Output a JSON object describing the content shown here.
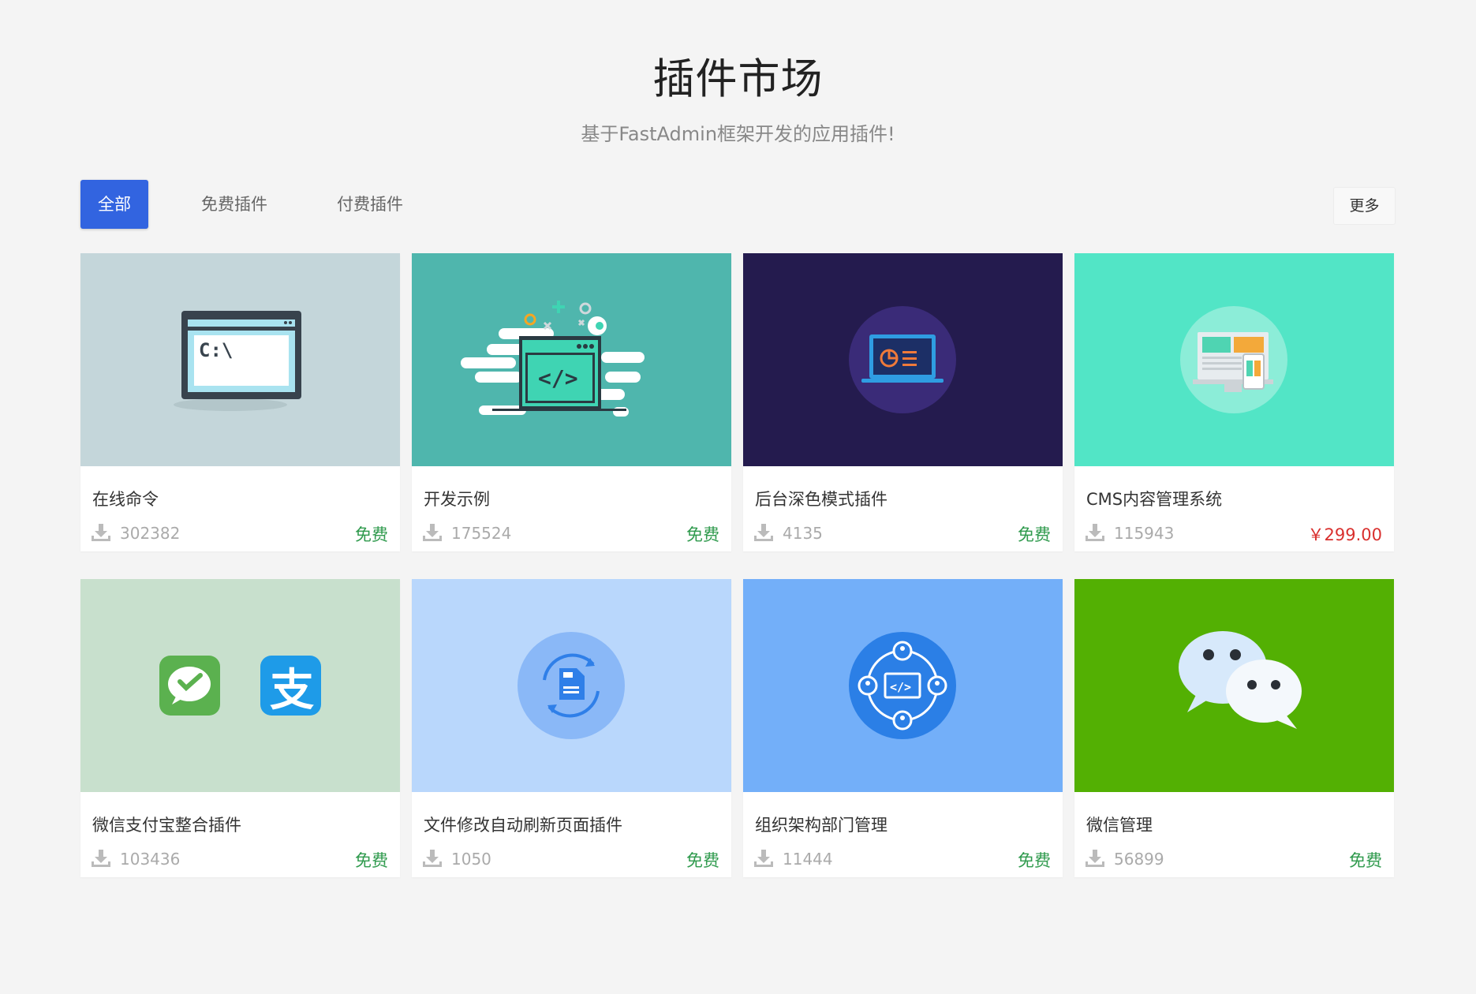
{
  "header": {
    "title": "插件市场",
    "subtitle": "基于FastAdmin框架开发的应用插件!"
  },
  "tabs": [
    {
      "label": "全部",
      "active": true
    },
    {
      "label": "免费插件",
      "active": false
    },
    {
      "label": "付费插件",
      "active": false
    }
  ],
  "more_label": "更多",
  "plugins": [
    {
      "title": "在线命令",
      "downloads": "302382",
      "price": "免费",
      "thumb_bg": "#c4d6da",
      "icon": "terminal-icon"
    },
    {
      "title": "开发示例",
      "downloads": "175524",
      "price": "免费",
      "thumb_bg": "#4fb6ad",
      "icon": "code-window-icon"
    },
    {
      "title": "后台深色模式插件",
      "downloads": "4135",
      "price": "免费",
      "thumb_bg": "#241b4e",
      "icon": "dashboard-laptop-icon"
    },
    {
      "title": "CMS内容管理系统",
      "downloads": "115943",
      "price": "￥299.00",
      "thumb_bg": "#52e5c6",
      "icon": "responsive-devices-icon"
    },
    {
      "title": "微信支付宝整合插件",
      "downloads": "103436",
      "price": "免费",
      "thumb_bg": "#c8e0cd",
      "icon": "wechatpay-alipay-icon"
    },
    {
      "title": "文件修改自动刷新页面插件",
      "downloads": "1050",
      "price": "免费",
      "thumb_bg": "#b9d7fc",
      "icon": "file-refresh-icon"
    },
    {
      "title": "组织架构部门管理",
      "downloads": "11444",
      "price": "免费",
      "thumb_bg": "#73aff9",
      "icon": "org-network-icon"
    },
    {
      "title": "微信管理",
      "downloads": "56899",
      "price": "免费",
      "thumb_bg": "#53b003",
      "icon": "wechat-chat-icon"
    }
  ],
  "colors": {
    "accent": "#3264e0",
    "free": "#2f9a4d",
    "paid": "#d9302e"
  }
}
